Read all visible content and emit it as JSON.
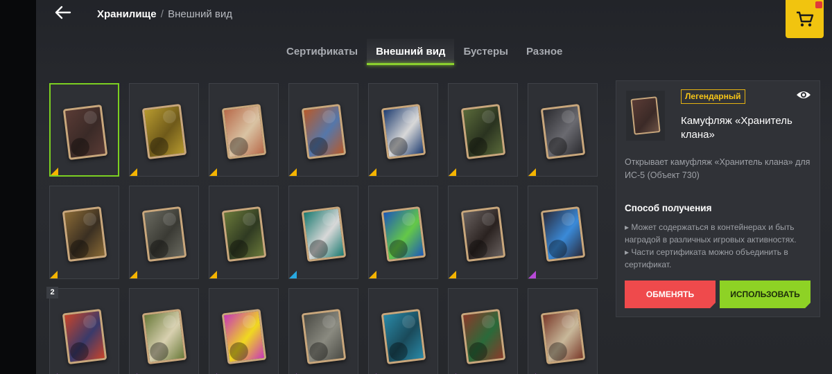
{
  "header": {
    "breadcrumb_current": "Хранилище",
    "breadcrumb_sep": "/",
    "breadcrumb_sub": "Внешний вид",
    "back_icon": "arrow-left-icon",
    "shop_icon": "cart-icon"
  },
  "tabs": [
    {
      "label": "Сертификаты",
      "active": false
    },
    {
      "label": "Внешний вид",
      "active": true
    },
    {
      "label": "Бустеры",
      "active": false
    },
    {
      "label": "Разное",
      "active": false
    }
  ],
  "grid": {
    "count_badge": "2",
    "rarity_colors": {
      "legendary": "#f5b400",
      "rare": "#28a8e0",
      "epic": "#b84ad8"
    },
    "items": [
      {
        "rarity": "legendary",
        "c1": "#5a3b35",
        "c2": "#3a2a27",
        "selected": true
      },
      {
        "rarity": "legendary",
        "c1": "#b79a2f",
        "c2": "#6f5a1a"
      },
      {
        "rarity": "legendary",
        "c1": "#b86a4a",
        "c2": "#d9c3a3"
      },
      {
        "rarity": "legendary",
        "c1": "#b85a2a",
        "c2": "#5577aa"
      },
      {
        "rarity": "legendary",
        "c1": "#1e3c70",
        "c2": "#d8d8d8"
      },
      {
        "rarity": "legendary",
        "c1": "#5a6a3a",
        "c2": "#2a3320"
      },
      {
        "rarity": "legendary",
        "c1": "#2a2a2e",
        "c2": "#6a6a70"
      },
      {
        "rarity": "legendary",
        "c1": "#8a6a35",
        "c2": "#3a2f22"
      },
      {
        "rarity": "legendary",
        "c1": "#6a6a60",
        "c2": "#3a3a34"
      },
      {
        "rarity": "legendary",
        "c1": "#6b7a3a",
        "c2": "#2f3a22"
      },
      {
        "rarity": "rare",
        "c1": "#1a7a70",
        "c2": "#d8d8d8"
      },
      {
        "rarity": "legendary",
        "c1": "#1e58b8",
        "c2": "#64c848"
      },
      {
        "rarity": "legendary",
        "c1": "#6a6260",
        "c2": "#2a2220"
      },
      {
        "rarity": "epic",
        "c1": "#2a2a3a",
        "c2": "#3a8ad8"
      },
      {
        "rarity": "epic",
        "c1": "#c8442a",
        "c2": "#3a3a6a"
      },
      {
        "rarity": "epic",
        "c1": "#6a7a3a",
        "c2": "#d8d0b0"
      },
      {
        "rarity": "epic",
        "c1": "#c838b8",
        "c2": "#f0d820"
      },
      {
        "rarity": "epic",
        "c1": "#4a4a44",
        "c2": "#8a8a80"
      },
      {
        "rarity": "epic",
        "c1": "#2a8aa8",
        "c2": "#1a4a5a"
      },
      {
        "rarity": "epic",
        "c1": "#8a3a2a",
        "c2": "#2a6a3a"
      },
      {
        "rarity": "epic",
        "c1": "#7a3a2a",
        "c2": "#c8b89a"
      }
    ]
  },
  "panel": {
    "rarity_label": "Легендарный",
    "eye_icon": "eye-icon",
    "title": "Камуфляж «Хранитель клана»",
    "description": "Открывает камуфляж «Хранитель клана» для ИС-5 (Объект 730)",
    "method_title": "Способ получения",
    "method_lines": [
      "▸ Может содержаться в контейнерах и быть наградой в различных игровых активностях.",
      "▸ Части сертификата можно объединить в сертификат."
    ],
    "exchange_label": "ОБМЕНЯТЬ",
    "use_label": "ИСПОЛЬЗОВАТЬ",
    "colors": {
      "accent": "#8ed225",
      "danger": "#ef4a4c",
      "legendary": "#f5c518"
    }
  }
}
